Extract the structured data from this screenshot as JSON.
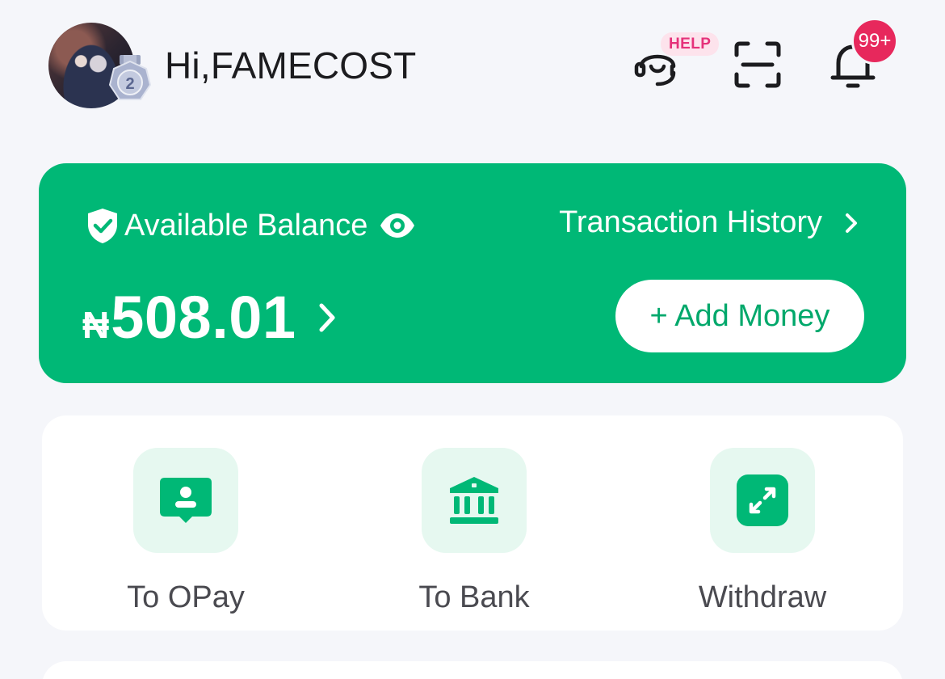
{
  "header": {
    "greeting": "Hi,FAMECOST",
    "avatar_icon": "user-avatar",
    "medal_level": "2",
    "help_badge": "HELP",
    "notification_count": "99+"
  },
  "balance": {
    "label": "Available Balance",
    "currency_symbol": "₦",
    "amount": "508.01",
    "history_label": "Transaction History",
    "add_money_label": "+ Add Money"
  },
  "actions": [
    {
      "label": "To OPay",
      "icon": "opay-user-icon"
    },
    {
      "label": "To Bank",
      "icon": "bank-icon"
    },
    {
      "label": "Withdraw",
      "icon": "withdraw-icon"
    }
  ],
  "colors": {
    "brand_green": "#00b876",
    "tile_bg": "#e6f8f0",
    "badge_red": "#e7285c",
    "help_pink": "#e5327a",
    "page_bg": "#f5f6fa"
  }
}
